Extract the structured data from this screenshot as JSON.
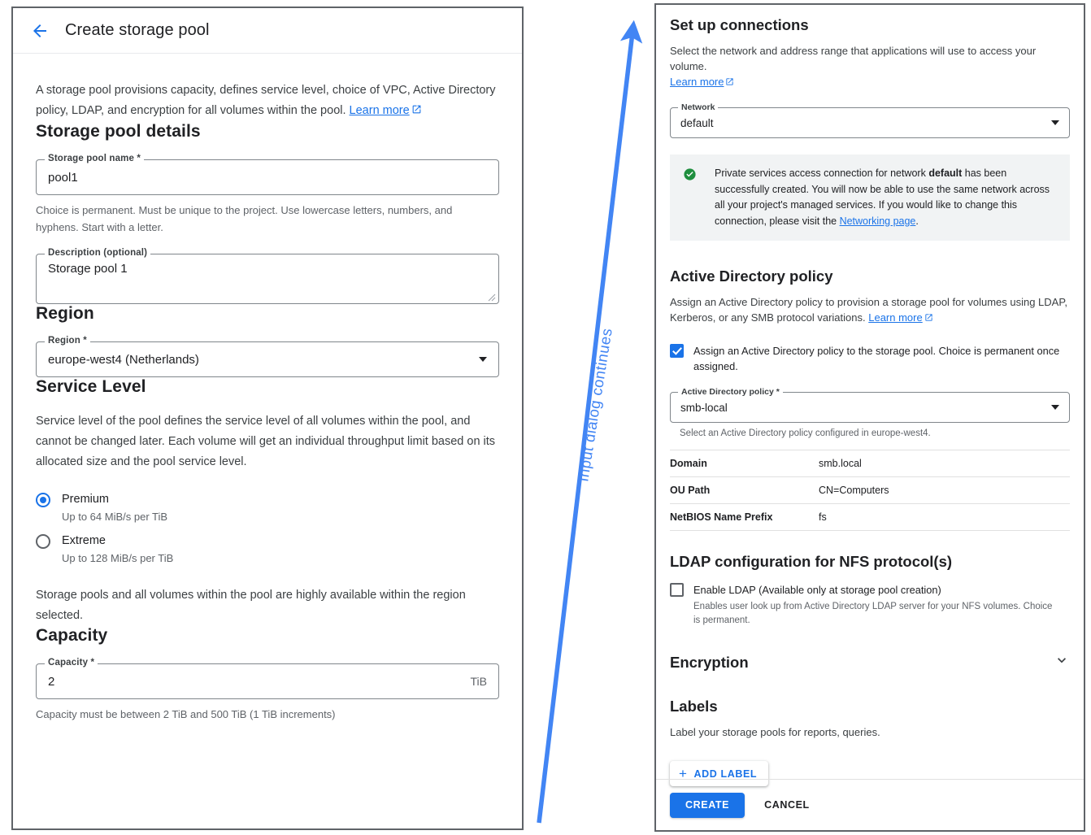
{
  "left_panel": {
    "header": {
      "back_icon": "back-arrow-icon",
      "title": "Create storage pool"
    },
    "intro": "A storage pool provisions capacity, defines service level, choice of VPC, Active Directory policy, LDAP, and encryption for all volumes within the pool. ",
    "intro_link": "Learn more",
    "storage_pool_details": {
      "heading": "Storage pool details",
      "name_label": "Storage pool name *",
      "name_value": "pool1",
      "name_helper": "Choice is permanent. Must be unique to the project. Use lowercase letters, numbers, and hyphens. Start with a letter.",
      "description_label": "Description (optional)",
      "description_value": "Storage pool 1"
    },
    "region": {
      "heading": "Region",
      "label": "Region *",
      "value": "europe-west4 (Netherlands)"
    },
    "service_level": {
      "heading": "Service Level",
      "description": "Service level of the pool defines the service level of all volumes within the pool, and cannot be changed later. Each volume will get an individual throughput limit based on its allocated size and the pool service level.",
      "options": [
        {
          "label": "Premium",
          "sub": "Up to 64 MiB/s per TiB",
          "selected": true
        },
        {
          "label": "Extreme",
          "sub": "Up to 128 MiB/s per TiB",
          "selected": false
        }
      ],
      "availability_note": "Storage pools and all volumes within the pool are highly available within the region selected."
    },
    "capacity": {
      "heading": "Capacity",
      "label": "Capacity *",
      "value": "2",
      "unit": "TiB",
      "helper": "Capacity must be between 2 TiB and 500 TiB (1 TiB increments)"
    }
  },
  "right_panel": {
    "connections": {
      "heading": "Set up connections",
      "description": "Select the network and address range that applications will use to access your volume.",
      "link": "Learn more",
      "network_label": "Network",
      "network_value": "default"
    },
    "notice": {
      "icon": "check-circle-icon",
      "text_before": "Private services access connection for network ",
      "bold": "default",
      "text_mid": " has been successfully created. You will now be able to use the same network across all your project's managed services. If you would like to change this connection, please visit the ",
      "link": "Networking page",
      "text_after": "."
    },
    "ad_policy": {
      "heading": "Active Directory policy",
      "description": "Assign an Active Directory policy to provision a storage pool for volumes using LDAP, Kerberos, or any SMB protocol variations. ",
      "link": "Learn more",
      "checkbox_label": "Assign an Active Directory policy to the storage pool. Choice is permanent once assigned.",
      "checkbox_checked": true,
      "select_label": "Active Directory policy *",
      "select_value": "smb-local",
      "select_helper": "Select an Active Directory policy configured in europe-west4.",
      "table": [
        {
          "key": "Domain",
          "value": "smb.local"
        },
        {
          "key": "OU Path",
          "value": "CN=Computers"
        },
        {
          "key": "NetBIOS Name Prefix",
          "value": "fs"
        }
      ]
    },
    "ldap": {
      "heading": "LDAP configuration for NFS protocol(s)",
      "checkbox_label": "Enable LDAP (Available only at storage pool creation)",
      "checkbox_checked": false,
      "helper": "Enables user look up from Active Directory LDAP server for your NFS volumes. Choice is permanent."
    },
    "encryption": {
      "heading": "Encryption",
      "chevron": "chevron-down-icon"
    },
    "labels": {
      "heading": "Labels",
      "description": "Label your storage pools for reports, queries.",
      "add_button": "ADD LABEL"
    },
    "footer": {
      "create": "CREATE",
      "cancel": "CANCEL"
    }
  },
  "annotation": {
    "text": "Input dialog  continues",
    "color": "#4285f4"
  }
}
